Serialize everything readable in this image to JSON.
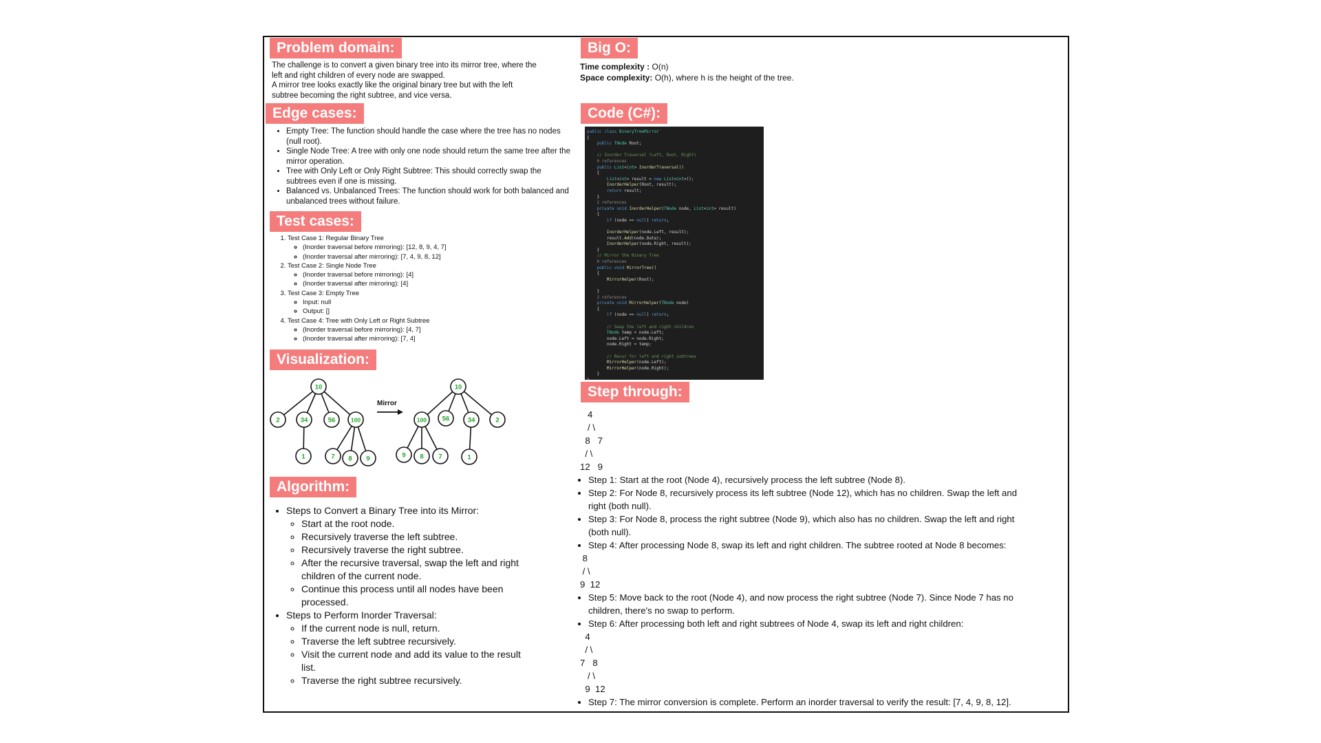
{
  "problem": {
    "header": "Problem domain:",
    "lines": [
      "The challenge is to convert a given binary tree into its mirror tree, where the",
      "left and right children of every node are swapped.",
      "A mirror tree looks exactly like the original binary tree but with the left",
      "subtree becoming the right subtree, and vice versa."
    ]
  },
  "edge": {
    "header": "Edge cases:",
    "items": [
      [
        "Empty Tree: The function should handle the case where the tree has no nodes",
        "(null root)."
      ],
      [
        "Single Node Tree: A tree with only one node should return the same tree after the",
        "mirror operation."
      ],
      [
        "Tree with Only Left or Only Right Subtree: This should correctly swap the",
        "subtrees even if one is missing."
      ],
      [
        "Balanced vs. Unbalanced Trees: The function should work for both balanced and",
        "unbalanced trees without failure."
      ]
    ]
  },
  "tests": {
    "header": "Test cases:",
    "cases": [
      {
        "title": "Test Case 1: Regular Binary Tree",
        "subs": [
          "(Inorder traversal before mirroring): [12, 8, 9, 4, 7]",
          "(Inorder traversal after mirroring): [7, 4, 9, 8, 12]"
        ]
      },
      {
        "title": "Test Case 2: Single Node Tree",
        "subs": [
          "(Inorder traversal before mirroring): [4]",
          "(Inorder traversal after mirroring): [4]"
        ]
      },
      {
        "title": "Test Case 3: Empty Tree",
        "subs": [
          "Input: null",
          "Output: []"
        ]
      },
      {
        "title": "Test Case 4: Tree with Only Left or Right Subtree",
        "subs": [
          "(Inorder traversal before mirroring): [4, 7]",
          "(Inorder traversal after mirroring): [7, 4]"
        ]
      }
    ]
  },
  "viz": {
    "header": "Visualization:",
    "arrow_label": "Mirror",
    "left_tree": {
      "root": "10",
      "children": [
        "2",
        "34",
        "56",
        "100"
      ],
      "grand_34": [
        "1"
      ],
      "grand_100": [
        "7",
        "8",
        "9"
      ]
    },
    "right_tree": {
      "root": "10",
      "children": [
        "100",
        "56",
        "34",
        "2"
      ],
      "grand_100": [
        "9",
        "8",
        "7"
      ],
      "grand_34": [
        "1"
      ]
    }
  },
  "algorithm": {
    "header": "Algorithm:",
    "groups": [
      {
        "title": "Steps to Convert a Binary Tree into its Mirror:",
        "subs": [
          [
            "Start at the root node."
          ],
          [
            "Recursively traverse the left subtree."
          ],
          [
            "Recursively traverse the right subtree."
          ],
          [
            "After the recursive traversal, swap the left and right",
            "children of the current node."
          ],
          [
            "Continue this process until all nodes have been",
            "processed."
          ]
        ]
      },
      {
        "title": "Steps to Perform Inorder Traversal:",
        "subs": [
          [
            "If the current node is null, return."
          ],
          [
            "Traverse the left subtree recursively."
          ],
          [
            "Visit the current node and add its value to the result",
            "list."
          ],
          [
            "Traverse the right subtree recursively."
          ]
        ]
      }
    ]
  },
  "bigo": {
    "header": "Big O:",
    "time_label": "Time complexity :",
    "time_value": " O(n)",
    "space_label": "Space complexity:",
    "space_value": " O(h), where h is the height of the tree."
  },
  "code": {
    "header": "Code (C#):",
    "lines": [
      "public class BinaryTreeMirror",
      "{",
      "    public TNode Root;",
      "",
      "    // Inorder Traversal (Left, Root, Right)",
      "    0 references",
      "    public List<int> InorderTraversal()",
      "    {",
      "        List<int> result = new List<int>();",
      "        InorderHelper(Root, result);",
      "        return result;",
      "    }",
      "    2 references",
      "    private void InorderHelper(TNode node, List<int> result)",
      "    {",
      "        if (node == null) return;",
      "",
      "        InorderHelper(node.Left, result);",
      "        result.Add(node.Data);",
      "        InorderHelper(node.Right, result);",
      "    }",
      "    // Mirror the Binary Tree",
      "    0 references",
      "    public void MirrorTree()",
      "    {",
      "        MirrorHelper(Root);",
      "",
      "    }",
      "    2 references",
      "    private void MirrorHelper(TNode node)",
      "    {",
      "        if (node == null) return;",
      "",
      "        // Swap the left and right children",
      "        TNode temp = node.Left;",
      "        node.Left = node.Right;",
      "        node.Right = temp;",
      "",
      "        // Recur for left and right subtrees",
      "        MirrorHelper(node.Left);",
      "        MirrorHelper(node.Right);",
      "    }",
      "}"
    ]
  },
  "steps": {
    "header": "Step through:",
    "tree_lines": [
      "   4",
      "   / \\",
      "  8   7",
      "  / \\",
      "12   9"
    ],
    "items": [
      {
        "lines": [
          "Step 1: Start at the root (Node 4), recursively process the left subtree (Node 8)."
        ]
      },
      {
        "lines": [
          "Step 2: For Node 8, recursively process its left subtree (Node 12), which has no children. Swap the left and",
          "right (both null)."
        ]
      },
      {
        "lines": [
          "Step 3: For Node 8, process the right subtree (Node 9), which also has no children. Swap the left and right",
          "(both null)."
        ]
      },
      {
        "lines": [
          "Step 4: After processing Node 8, swap its left and right children. The subtree rooted at Node 8 becomes:"
        ],
        "after": [
          " 8",
          " / \\",
          "9  12"
        ]
      },
      {
        "lines": [
          "Step 5: Move back to the root (Node 4), and now process the right subtree (Node 7). Since Node 7 has no",
          "children, there's no swap to perform."
        ]
      },
      {
        "lines": [
          "Step 6: After processing both left and right subtrees of Node 4, swap its left and right children:"
        ],
        "after": [
          "  4",
          "  / \\",
          "7   8",
          "   / \\",
          "  9  12"
        ]
      },
      {
        "lines": [
          "Step 7: The mirror conversion is complete. Perform an inorder traversal to verify the result: [7, 4, 9, 8, 12]."
        ]
      }
    ]
  },
  "colors": {
    "accent": "#f47c7c",
    "node_text": "#22a32a",
    "code_bg": "#1e1e1e"
  }
}
